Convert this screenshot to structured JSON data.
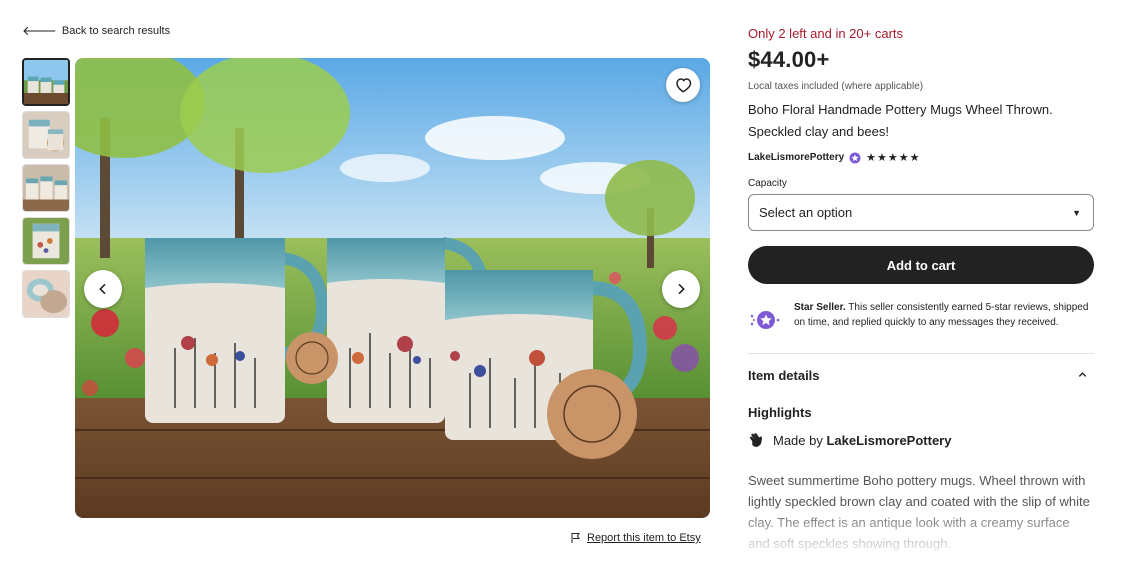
{
  "nav": {
    "back_label": "Back to search results"
  },
  "gallery": {
    "thumbnail_count": 5,
    "report_label": "Report this item to Etsy"
  },
  "listing": {
    "stock_notice": "Only 2 left and in 20+ carts",
    "price": "$44.00+",
    "tax_note": "Local taxes included (where applicable)",
    "title": "Boho Floral Handmade Pottery Mugs Wheel Thrown. Speckled clay and bees!",
    "shop_name": "LakeLismorePottery",
    "rating_stars": "★★★★★",
    "capacity_label": "Capacity",
    "capacity_placeholder": "Select an option",
    "add_to_cart_label": "Add to cart"
  },
  "star_seller": {
    "title": "Star Seller.",
    "text": " This seller consistently earned 5-star reviews, shipped on time, and replied quickly to any messages they received."
  },
  "item_details": {
    "heading": "Item details",
    "highlights_heading": "Highlights",
    "made_by_prefix": "Made by ",
    "made_by_shop": "LakeLismorePottery",
    "description": "Sweet summertime Boho pottery mugs. Wheel thrown with lightly speckled brown clay and coated with the slip of white clay. The effect is an antique look with a creamy surface and soft speckles showing through."
  },
  "colors": {
    "stock_red": "#a61a2e",
    "button_dark": "#222222",
    "star_seller_purple": "#7e5bd4"
  },
  "icons": [
    "back-arrow-icon",
    "heart-icon",
    "chevron-left-icon",
    "chevron-right-icon",
    "flag-icon",
    "star-seller-badge-icon",
    "dropdown-caret-icon",
    "chevron-up-icon",
    "hand-wave-icon"
  ]
}
